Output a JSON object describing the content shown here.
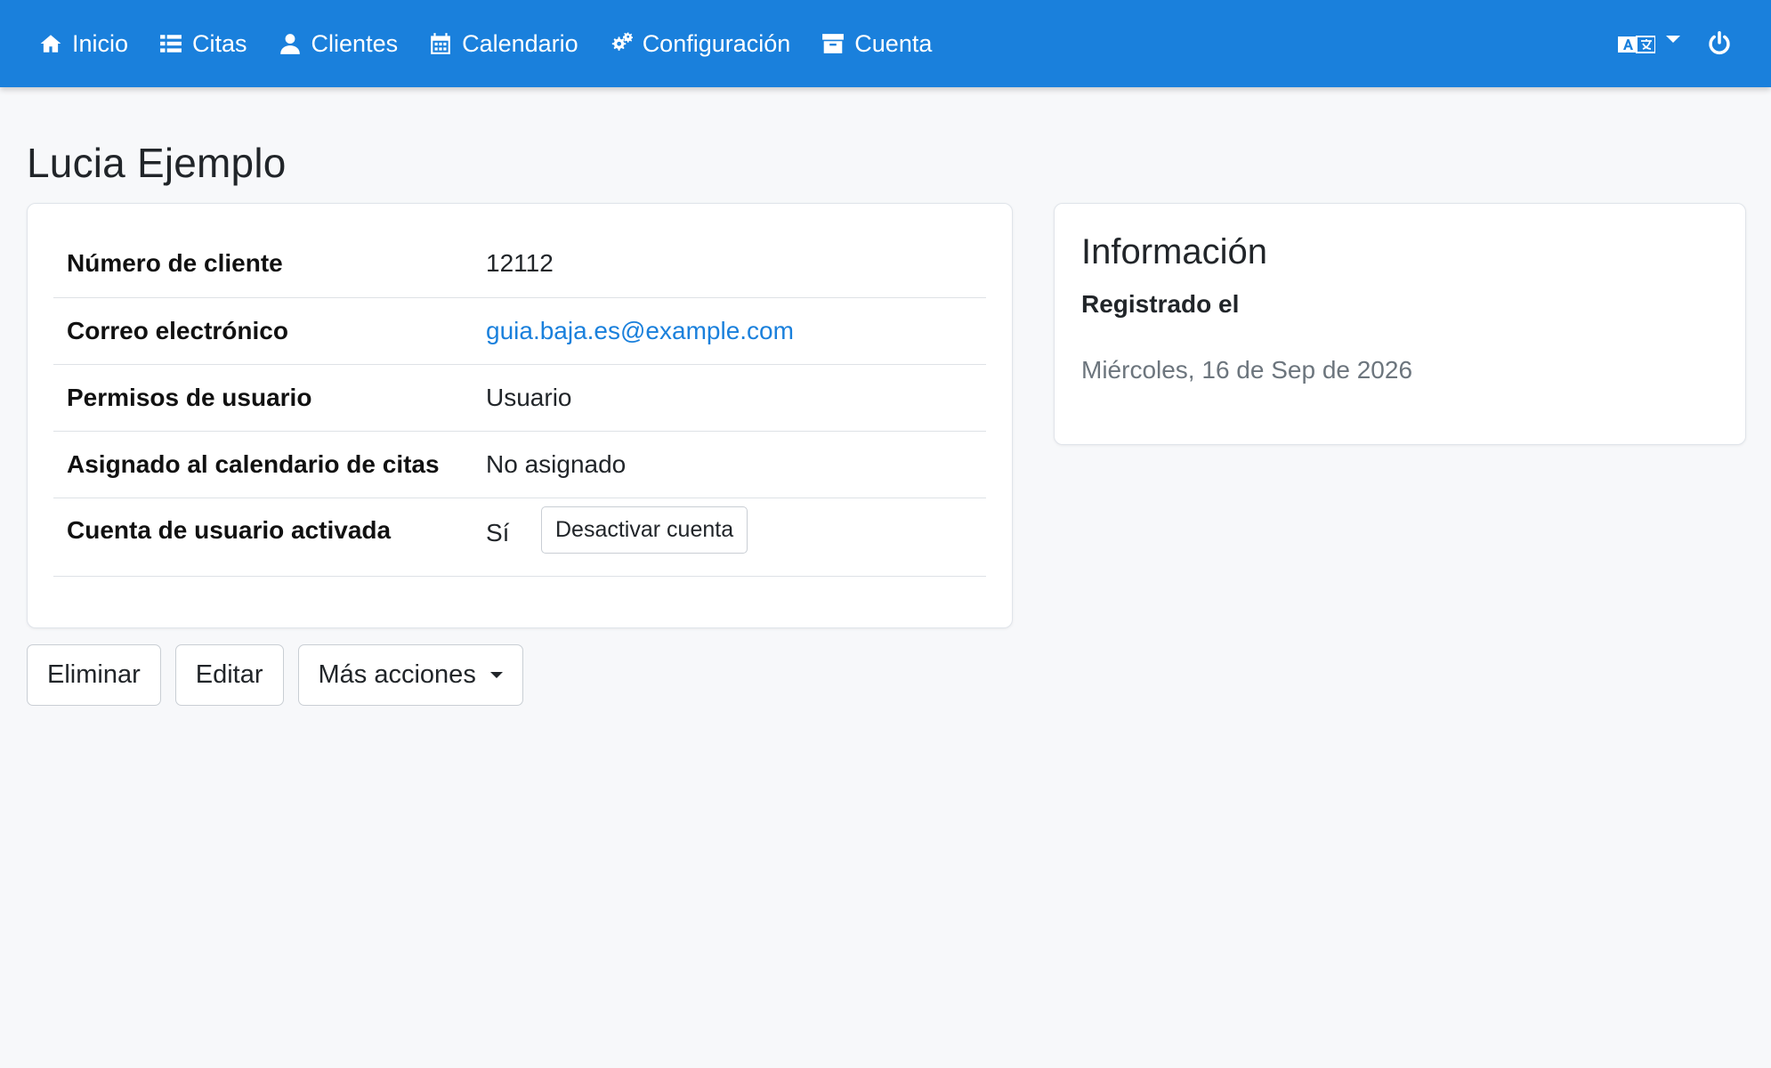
{
  "nav": {
    "items": [
      {
        "label": "Inicio",
        "icon": "home-icon"
      },
      {
        "label": "Citas",
        "icon": "list-icon"
      },
      {
        "label": "Clientes",
        "icon": "user-icon"
      },
      {
        "label": "Calendario",
        "icon": "calendar-icon"
      },
      {
        "label": "Configuración",
        "icon": "gears-icon"
      },
      {
        "label": "Cuenta",
        "icon": "archive-icon"
      }
    ],
    "language_icon": "language-icon",
    "logout_icon": "power-icon",
    "bar_color": "#1a80dc"
  },
  "customer": {
    "name": "Lucia Ejemplo",
    "fields": [
      {
        "label": "Número de cliente",
        "value": "12112"
      },
      {
        "label": "Correo electrónico",
        "value": "guia.baja.es@example.com"
      },
      {
        "label": "Permisos de usuario",
        "value": "Usuario"
      },
      {
        "label": "Asignado al calendario de citas",
        "value": "No asignado"
      },
      {
        "label": "Cuenta de usuario activada",
        "value": "Sí"
      }
    ],
    "deactivate_label": "Desactivar cuenta"
  },
  "info": {
    "title": "Información",
    "registered_label": "Registrado el",
    "registered_value": "Miércoles, 16 de Sep de 2026"
  },
  "actions": {
    "delete_label": "Eliminar",
    "edit_label": "Editar",
    "more_label": "Más acciones"
  }
}
